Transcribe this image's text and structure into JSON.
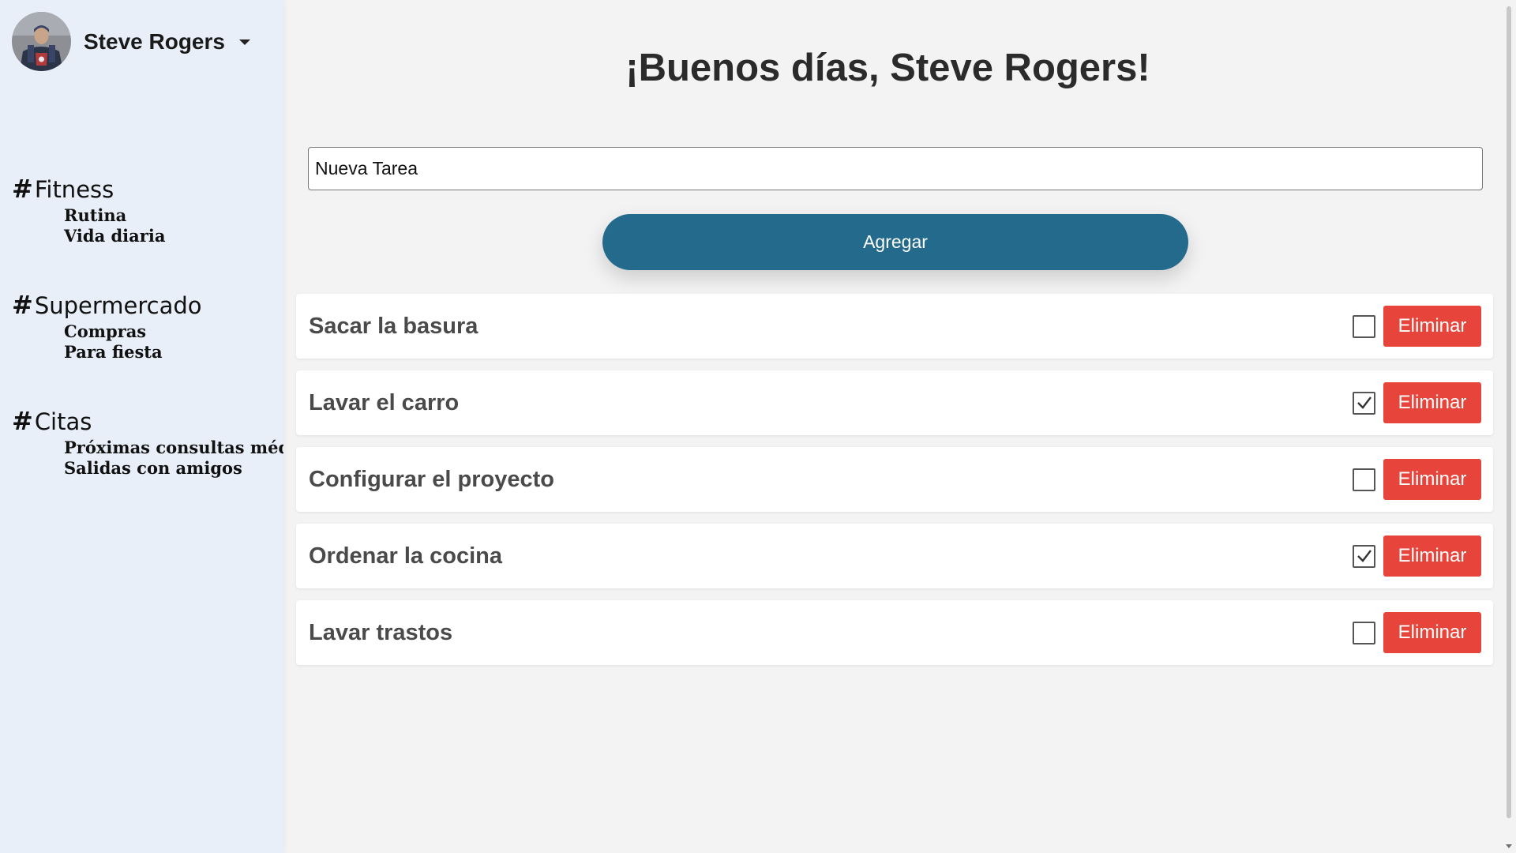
{
  "user": {
    "name": "Steve Rogers"
  },
  "sidebar": {
    "categories": [
      {
        "hash": "#",
        "title": "Fitness",
        "items": [
          "Rutina",
          "Vida diaria"
        ]
      },
      {
        "hash": "#",
        "title": "Supermercado",
        "items": [
          "Compras",
          "Para fiesta"
        ]
      },
      {
        "hash": "#",
        "title": "Citas",
        "items": [
          "Próximas consultas médic",
          "Salidas con amigos"
        ]
      }
    ]
  },
  "main": {
    "greeting": "¡Buenos días, Steve Rogers!",
    "input": {
      "value": "Nueva Tarea",
      "placeholder": ""
    },
    "add_label": "Agregar",
    "tasks": [
      {
        "title": "Sacar la basura",
        "done": false,
        "delete_label": "Eliminar"
      },
      {
        "title": "Lavar el carro",
        "done": true,
        "delete_label": "Eliminar"
      },
      {
        "title": "Configurar el proyecto",
        "done": false,
        "delete_label": "Eliminar"
      },
      {
        "title": "Ordenar la cocina",
        "done": true,
        "delete_label": "Eliminar"
      },
      {
        "title": "Lavar trastos",
        "done": false,
        "delete_label": "Eliminar"
      }
    ]
  },
  "colors": {
    "sidebar_bg": "#e9eff9",
    "page_bg": "#f3f3f3",
    "primary": "#236a8c",
    "danger": "#e7453b"
  }
}
